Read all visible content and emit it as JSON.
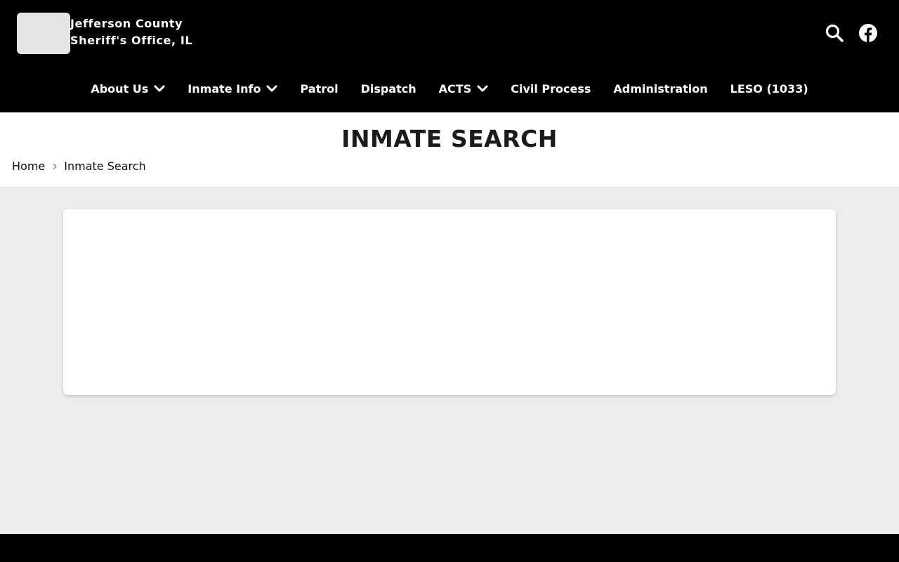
{
  "site": {
    "title_line1": "Jefferson County",
    "title_line2": "Sheriff's Office, IL"
  },
  "header": {
    "icons": [
      "search-icon",
      "facebook-icon"
    ]
  },
  "nav": {
    "items": [
      {
        "label": "About Us",
        "dropdown": true
      },
      {
        "label": "Inmate Info",
        "dropdown": true
      },
      {
        "label": "Patrol",
        "dropdown": false
      },
      {
        "label": "Dispatch",
        "dropdown": false
      },
      {
        "label": "ACTS",
        "dropdown": true
      },
      {
        "label": "Civil Process",
        "dropdown": false
      },
      {
        "label": "Administration",
        "dropdown": false
      },
      {
        "label": "LESO (1033)",
        "dropdown": false
      }
    ]
  },
  "page": {
    "title": "INMATE SEARCH",
    "breadcrumb": {
      "home": "Home",
      "current": "Inmate Search"
    }
  },
  "colors": {
    "header_bg": "#000000",
    "body_bg": "#ededed",
    "card_bg": "#ffffff",
    "title_text": "#1b1b1b"
  }
}
